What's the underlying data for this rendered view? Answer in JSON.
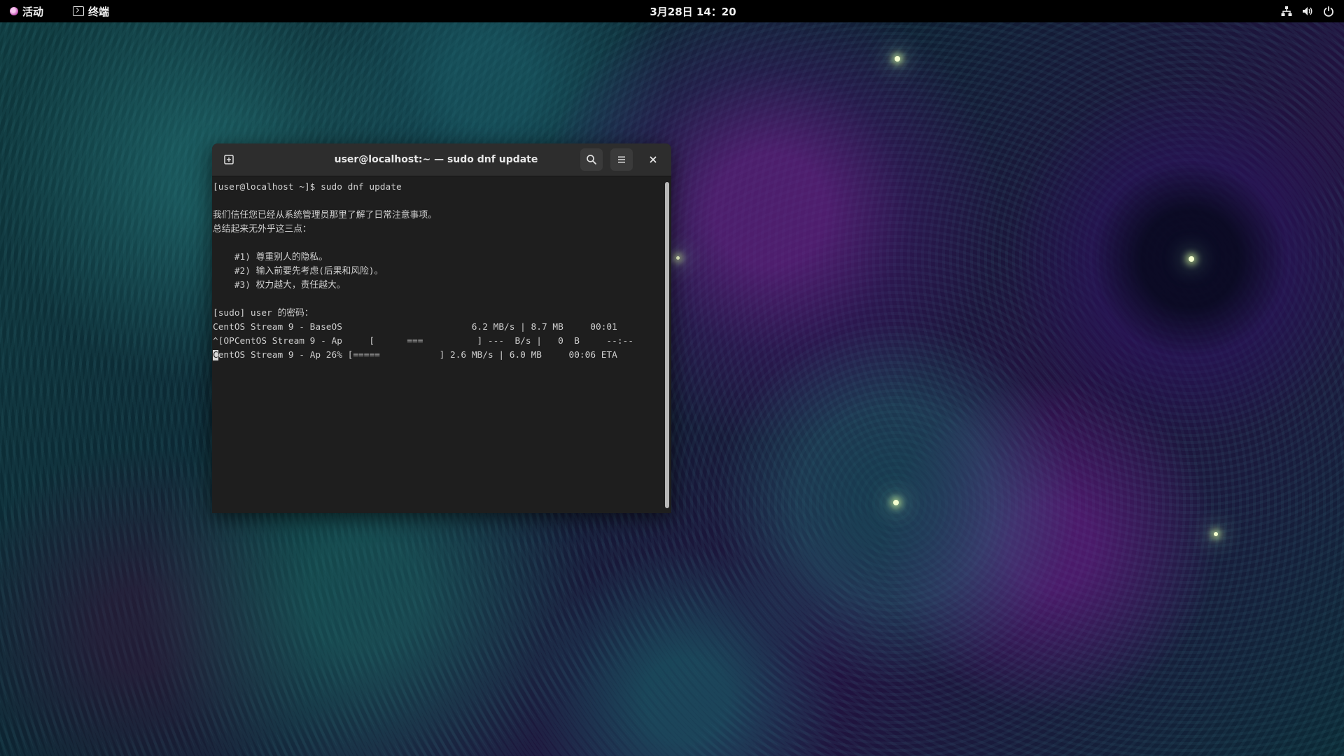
{
  "topbar": {
    "activities_label": "活动",
    "app_label": "终端",
    "clock": "3月28日 14：20",
    "tray_icons": [
      "network-wired-icon",
      "volume-icon",
      "power-icon"
    ]
  },
  "window": {
    "title": "user@localhost:~ — sudo dnf update",
    "buttons": [
      "new-tab-icon",
      "search-icon",
      "hamburger-menu-icon",
      "close-icon"
    ]
  },
  "terminal": {
    "lines": [
      "[user@localhost ~]$ sudo dnf update",
      "",
      "我们信任您已经从系统管理员那里了解了日常注意事项。",
      "总结起来无外乎这三点：",
      "",
      "    #1) 尊重别人的隐私。",
      "    #2) 输入前要先考虑(后果和风险)。",
      "    #3) 权力越大，责任越大。",
      "",
      "[sudo] user 的密码：",
      "CentOS Stream 9 - BaseOS                        6.2 MB/s | 8.7 MB     00:01",
      "^[OPCentOS Stream 9 - Ap     [      ===          ] ---  B/s |   0  B     --:--"
    ],
    "cursor_char": "C",
    "last_line_rest": "entOS Stream 9 - Ap 26% [=====           ] 2.6 MB/s | 6.0 MB     00:06 ETA"
  },
  "colors": {
    "topbar_bg": "#000000",
    "headerbar_bg": "#2d2d2d",
    "terminal_bg": "#1e1e1e",
    "terminal_fg": "#d0d0d0"
  }
}
